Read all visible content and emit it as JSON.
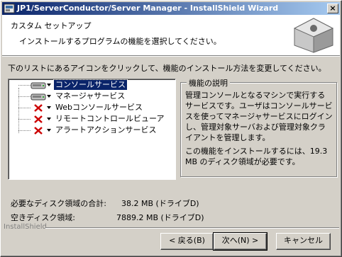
{
  "window": {
    "title": "JP1/ServerConductor/Server Manager - InstallShield Wizard",
    "close_label": "×"
  },
  "header": {
    "title": "カスタム セットアップ",
    "subtitle": "インストールするプログラムの機能を選択してください。"
  },
  "instruction": "下のリストにあるアイコンをクリックして、機能のインストール方法を変更してください。",
  "features": [
    {
      "label": "コンソールサービス",
      "state": "install",
      "selected": true
    },
    {
      "label": "マネージャサービス",
      "state": "install",
      "selected": false
    },
    {
      "label": "Webコンソールサービス",
      "state": "not-installed",
      "selected": false
    },
    {
      "label": "リモートコントロールビューア",
      "state": "not-installed",
      "selected": false
    },
    {
      "label": "アラートアクションサービス",
      "state": "not-installed",
      "selected": false
    }
  ],
  "description": {
    "legend": "機能の説明",
    "text": "管理コンソールとなるマシンで実行するサービスです。ユーザはコンソールサービスを使ってマネージャサービスにログインし、管理対象サーバおよび管理対象クライアントを管理します。",
    "requirement": "この機能をインストールするには、19.3 MB のディスク領域が必要です。"
  },
  "disk": {
    "required_label": "必要なディスク領域の合計:",
    "required_value": "38.2 MB (ドライブD)",
    "free_label": "空きディスク領域:",
    "free_value": "7889.2 MB (ドライブD)"
  },
  "footer": {
    "brand": "InstallShield",
    "back_label": "< 戻る(B)",
    "next_label": "次へ(N) >",
    "cancel_label": "キャンセル"
  },
  "colors": {
    "titlebar_start": "#0a246a",
    "titlebar_end": "#a6caf0",
    "selection": "#0a246a",
    "not_installed_x": "#cc0000"
  }
}
